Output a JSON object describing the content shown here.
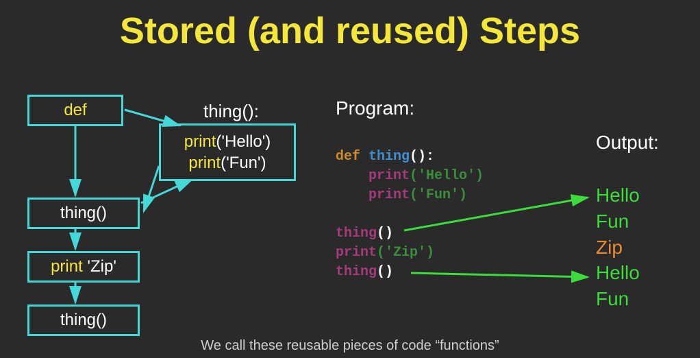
{
  "title": "Stored (and reused) Steps",
  "flow": {
    "def": "def",
    "thing_header": "thing():",
    "body_line1_fn": "print",
    "body_line1_arg": "('Hello')",
    "body_line2_fn": "print",
    "body_line2_arg": "('Fun')",
    "call1": "thing()",
    "print_kw": "print",
    "print_arg": " 'Zip'",
    "call2": "thing()"
  },
  "program": {
    "label": "Program:",
    "def_kw": "def",
    "def_name": " thing",
    "def_paren": "():",
    "indent": "    ",
    "print_kw": "print",
    "hello_arg": "('Hello')",
    "fun_arg": "('Fun')",
    "call1": "thing",
    "call1_paren": "()",
    "print_zip_kw": "print",
    "zip_arg": "('Zip')",
    "call2": "thing",
    "call2_paren": "()"
  },
  "output": {
    "label": "Output:",
    "lines": [
      "Hello",
      "Fun",
      "Zip",
      "Hello",
      "Fun"
    ]
  },
  "caption": "We call these reusable pieces of code “functions”"
}
